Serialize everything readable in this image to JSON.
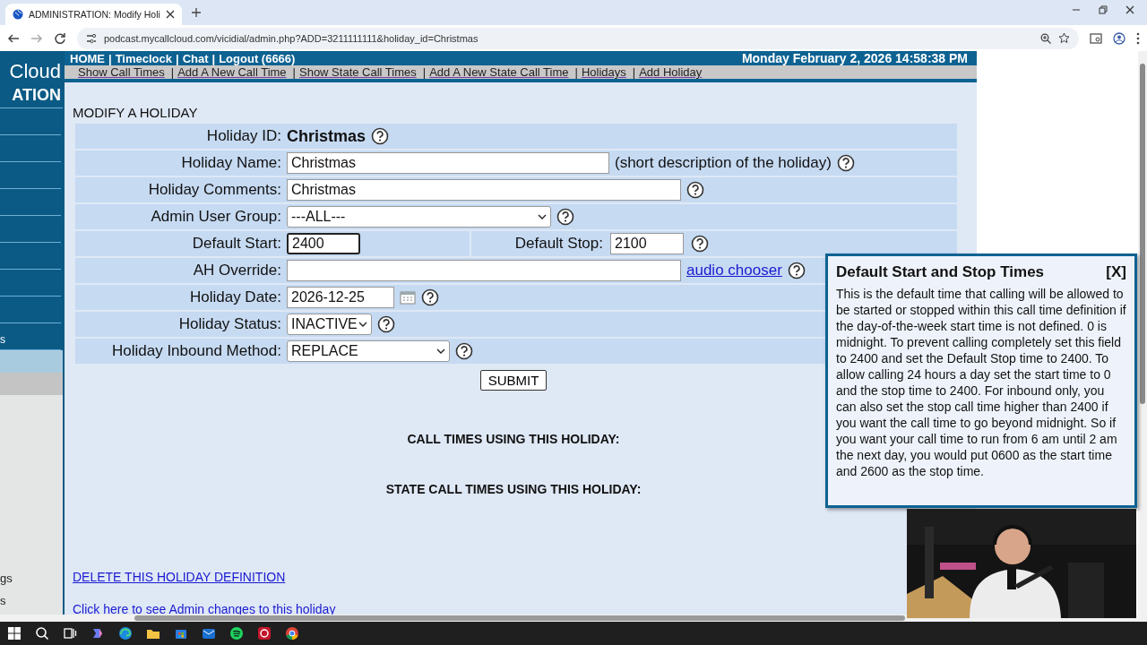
{
  "browser": {
    "tab_title": "ADMINISTRATION: Modify Holi",
    "url": "podcast.mycallcloud.com/vicidial/admin.php?ADD=3211111111&holiday_id=Christmas"
  },
  "sidebar": {
    "logo_text": "Cloud",
    "title": "ATION",
    "menu_items": [
      {
        "label": "s"
      }
    ],
    "lower_items": [
      {
        "label": "gs"
      },
      {
        "label": "s"
      }
    ]
  },
  "header": {
    "separator": "|",
    "links": [
      "HOME",
      "Timeclock",
      "Chat",
      "Logout (6666)"
    ],
    "datetime": "Monday February 2, 2026 14:58:38 PM"
  },
  "subnav": {
    "separator": "|",
    "links": [
      "Show Call Times",
      "Add A New Call Time",
      "Show State Call Times",
      "Add A New State Call Time",
      "Holidays",
      "Add Holiday"
    ]
  },
  "form": {
    "heading": "MODIFY A HOLIDAY",
    "rows": [
      {
        "kind": "static",
        "label": "Holiday ID:",
        "value": "Christmas"
      },
      {
        "kind": "text",
        "label": "Holiday Name:",
        "value": "Christmas",
        "note": "(short description of the holiday)"
      },
      {
        "kind": "text",
        "label": "Holiday Comments:",
        "value": "Christmas"
      },
      {
        "kind": "select",
        "label": "Admin User Group:",
        "value": "---ALL---"
      },
      {
        "kind": "start_stop",
        "label": "Default Start:",
        "value": "2400",
        "focused": true,
        "stop_label": "Default Stop:",
        "stop_value": "2100"
      },
      {
        "kind": "text",
        "label": "AH Override:",
        "link": "audio chooser"
      },
      {
        "kind": "date",
        "label": "Holiday Date:",
        "value": "2026-12-25"
      },
      {
        "kind": "select",
        "label": "Holiday Status:",
        "value": "INACTIVE"
      },
      {
        "kind": "select",
        "label": "Holiday Inbound Method:",
        "value": "REPLACE"
      }
    ],
    "submit": "SUBMIT"
  },
  "sections": [
    "CALL TIMES USING THIS HOLIDAY:",
    "STATE CALL TIMES USING THIS HOLIDAY:"
  ],
  "links": [
    "DELETE THIS HOLIDAY DEFINITION",
    "Click here to see Admin changes to this holiday"
  ],
  "popup": {
    "title": "Default Start and Stop Times",
    "close": "[X]",
    "body": "This is the default time that calling will be allowed to be started or stopped within this call time definition if the day-of-the-week start time is not defined. 0 is midnight. To prevent calling completely set this field to 2400 and set the Default Stop time to 2400. To allow calling 24 hours a day set the start time to 0 and the stop time to 2400. For inbound only, you can also set the stop call time higher than 2400 if you want the call time to go beyond midnight. So if you want your call time to run from 6 am until 2 am the next day, you would put 0600 as the start time and 2600 as the stop time."
  }
}
